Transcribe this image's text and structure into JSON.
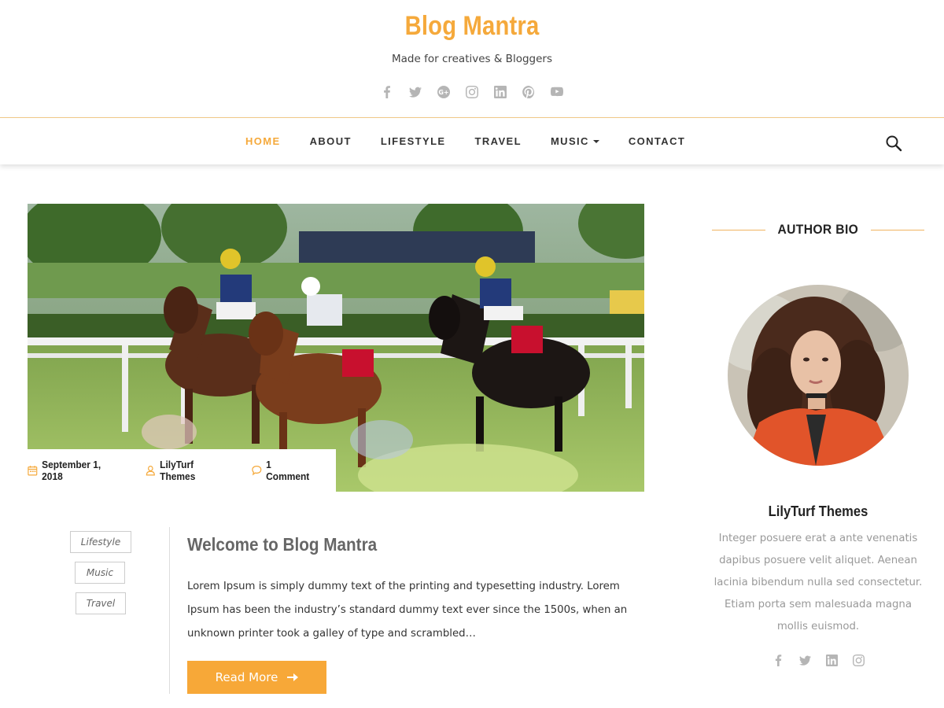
{
  "header": {
    "site_title": "Blog Mantra",
    "tagline": "Made for creatives & Bloggers",
    "social_icons": [
      "facebook-icon",
      "twitter-icon",
      "google-plus-icon",
      "instagram-icon",
      "linkedin-icon",
      "pinterest-icon",
      "youtube-icon"
    ]
  },
  "nav": {
    "items": [
      {
        "label": "HOME",
        "active": true
      },
      {
        "label": "ABOUT"
      },
      {
        "label": "LIFESTYLE"
      },
      {
        "label": "TRAVEL"
      },
      {
        "label": "MUSIC",
        "has_dropdown": true
      },
      {
        "label": "CONTACT"
      }
    ],
    "search_icon": "search-icon"
  },
  "post": {
    "meta": {
      "date": "September 1, 2018",
      "author": "LilyTurf Themes",
      "comments": "1 Comment"
    },
    "tags": [
      "Lifestyle",
      "Music",
      "Travel"
    ],
    "title": "Welcome to Blog Mantra",
    "excerpt": "Lorem Ipsum is simply dummy text of the printing and typesetting industry. Lorem Ipsum has been the industry’s standard dummy text ever since the 1500s, when an unknown printer took a galley of type and scrambled…",
    "read_more": "Read More"
  },
  "sidebar": {
    "widget_title": "AUTHOR BIO",
    "author_name": "LilyTurf Themes",
    "author_bio": "Integer posuere erat a ante venenatis dapibus posuere velit aliquet. Aenean lacinia bibendum nulla sed consectetur. Etiam porta sem malesuada magna mollis euismod.",
    "social_icons": [
      "facebook-icon",
      "twitter-icon",
      "linkedin-icon",
      "instagram-icon"
    ]
  },
  "colors": {
    "accent": "#f5a93b",
    "text": "#333333",
    "muted": "#999999"
  }
}
